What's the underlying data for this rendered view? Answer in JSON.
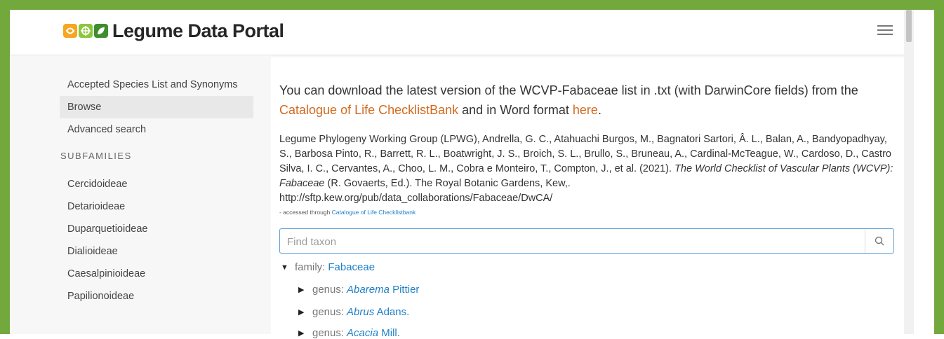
{
  "colors": {
    "frame": "#73a83c",
    "link_orange": "#d2691e",
    "link_blue": "#1e7fc6",
    "search_border": "#5b9fd6"
  },
  "header": {
    "logo_text": "Legume Data Portal",
    "menu_icon": "hamburger-menu-icon"
  },
  "sidebar": {
    "items": [
      {
        "label": "Accepted Species List and Synonyms"
      },
      {
        "label": "Browse",
        "active": true
      },
      {
        "label": "Advanced search"
      }
    ],
    "subfamilies_heading": "SUBFAMILIES",
    "subfamilies": [
      {
        "label": "Cercidoideae"
      },
      {
        "label": "Detarioideae"
      },
      {
        "label": "Duparquetioideae"
      },
      {
        "label": "Dialioideae"
      },
      {
        "label": "Caesalpinioideae"
      },
      {
        "label": "Papilionoideae"
      }
    ]
  },
  "main": {
    "intro_text_1": "You can download the latest version of the WCVP-Fabaceae list in .txt (with DarwinCore fields) from the",
    "intro_link_1": "Catalogue of Life ChecklistBank",
    "intro_text_2": " and in Word format ",
    "intro_link_2": "here",
    "intro_text_3": ".",
    "citation_text": "Legume Phylogeny Working Group (LPWG), Andrella, G. C., Atahuachi Burgos, M., Bagnatori Sartori, Â. L., Balan, A., Bandyopadhyay, S., Barbosa Pinto, R., Barrett, R. L., Boatwright, J. S., Broich, S. L., Brullo, S., Bruneau, A., Cardinal-McTeague, W., Cardoso, D., Castro Silva, I. C., Cervantes, A., Choo, L. M., Cobra e Monteiro, T., Compton, J., et al. (2021). ",
    "citation_title": "The World Checklist of Vascular Plants (WCVP): Fabaceae",
    "citation_tail": " (R. Govaerts, Ed.). The Royal Botanic Gardens, Kew,.",
    "citation_url": "http://sftp.kew.org/pub/data_collaborations/Fabaceae/DwCA/",
    "access_note": "- accessed through ",
    "access_link": "Catalogue of Life Checklistbank",
    "search": {
      "placeholder": "Find taxon",
      "icon": "search-icon"
    },
    "tree": {
      "root": {
        "rank": "family: ",
        "name": "Fabaceae"
      },
      "children": [
        {
          "rank": "genus: ",
          "genus": "Abarema",
          "author": " Pittier"
        },
        {
          "rank": "genus: ",
          "genus": "Abrus",
          "author": " Adans."
        },
        {
          "rank": "genus: ",
          "genus": "Acacia",
          "author": " Mill."
        }
      ]
    }
  }
}
